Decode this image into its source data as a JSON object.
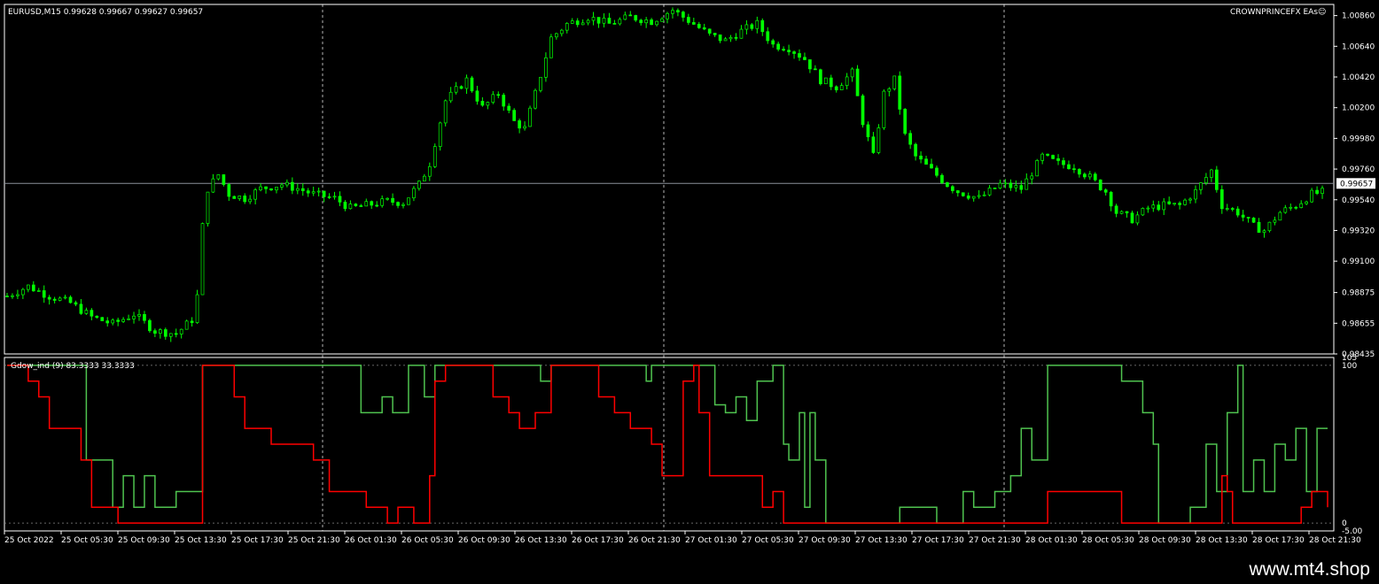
{
  "header": {
    "symbol_line": "EURUSD,M15  0.99628 0.99667 0.99627 0.99657",
    "brand": "CROWNPRINCEFX EAs☺"
  },
  "indicator_header": "Gdow_ind (9) 83.3333 33.3333",
  "current_price_label": "0.99657",
  "watermark": "www.mt4.shop",
  "colors": {
    "bull": "#00ff00",
    "bear": "#00ff00",
    "green_line": "#4fc34f",
    "red_line": "#ff0000",
    "grid": "#c0c0c0"
  },
  "chart_data": [
    {
      "type": "candlestick",
      "title": "EURUSD,M15",
      "ylim": [
        0.98435,
        0.1
      ],
      "y_ticks": [
        "1.00860",
        "1.00640",
        "1.00420",
        "1.00200",
        "0.99980",
        "0.99760",
        "0.99540",
        "0.99320",
        "0.99100",
        "0.98875",
        "0.98655",
        "0.98435"
      ],
      "current_price": 0.99657,
      "x_ticks": [
        "25 Oct 2022",
        "25 Oct 05:30",
        "25 Oct 09:30",
        "25 Oct 13:30",
        "25 Oct 17:30",
        "25 Oct 21:30",
        "26 Oct 01:30",
        "26 Oct 05:30",
        "26 Oct 09:30",
        "26 Oct 13:30",
        "26 Oct 17:30",
        "26 Oct 21:30",
        "27 Oct 01:30",
        "27 Oct 05:30",
        "27 Oct 09:30",
        "27 Oct 13:30",
        "27 Oct 17:30",
        "27 Oct 21:30",
        "28 Oct 01:30",
        "28 Oct 05:30",
        "28 Oct 09:30",
        "28 Oct 13:30",
        "28 Oct 17:30",
        "28 Oct 21:30"
      ],
      "close_path": [
        [
          0,
          0.9885
        ],
        [
          4,
          0.9892
        ],
        [
          8,
          0.9885
        ],
        [
          12,
          0.988
        ],
        [
          16,
          0.987
        ],
        [
          20,
          0.9865
        ],
        [
          24,
          0.9872
        ],
        [
          28,
          0.986
        ],
        [
          32,
          0.9858
        ],
        [
          35,
          0.9868
        ],
        [
          36,
          0.9885
        ],
        [
          37,
          0.9935
        ],
        [
          38,
          0.9962
        ],
        [
          40,
          0.9972
        ],
        [
          42,
          0.9958
        ],
        [
          45,
          0.9955
        ],
        [
          48,
          0.9962
        ],
        [
          52,
          0.9965
        ],
        [
          55,
          0.9962
        ],
        [
          58,
          0.9958
        ],
        [
          62,
          0.9955
        ],
        [
          65,
          0.9948
        ],
        [
          68,
          0.995
        ],
        [
          72,
          0.9953
        ],
        [
          75,
          0.9952
        ],
        [
          78,
          0.9965
        ],
        [
          80,
          0.998
        ],
        [
          83,
          1.0025
        ],
        [
          87,
          1.004
        ],
        [
          90,
          1.002
        ],
        [
          93,
          1.003
        ],
        [
          96,
          1.001
        ],
        [
          98,
          1.0005
        ],
        [
          100,
          1.003
        ],
        [
          103,
          1.007
        ],
        [
          106,
          1.008
        ],
        [
          110,
          1.0085
        ],
        [
          114,
          1.008
        ],
        [
          118,
          1.0085
        ],
        [
          122,
          1.0082
        ],
        [
          126,
          1.009
        ],
        [
          130,
          1.008
        ],
        [
          133,
          1.0072
        ],
        [
          136,
          1.0068
        ],
        [
          139,
          1.0075
        ],
        [
          142,
          1.008
        ],
        [
          145,
          1.0065
        ],
        [
          148,
          1.0063
        ],
        [
          151,
          1.0055
        ],
        [
          154,
          1.004
        ],
        [
          157,
          1.0035
        ],
        [
          160,
          1.0045
        ],
        [
          162,
          1.001
        ],
        [
          164,
          0.9985
        ],
        [
          166,
          1.003
        ],
        [
          168,
          1.004
        ],
        [
          170,
          1.0
        ],
        [
          172,
          0.9985
        ],
        [
          175,
          0.9975
        ],
        [
          178,
          0.9965
        ],
        [
          180,
          0.996
        ],
        [
          184,
          0.9955
        ],
        [
          188,
          0.9965
        ],
        [
          192,
          0.9962
        ],
        [
          196,
          0.9985
        ],
        [
          199,
          0.998
        ],
        [
          202,
          0.9978
        ],
        [
          205,
          0.997
        ],
        [
          208,
          0.996
        ],
        [
          210,
          0.9945
        ],
        [
          213,
          0.994
        ],
        [
          216,
          0.9948
        ],
        [
          219,
          0.995
        ],
        [
          222,
          0.995
        ],
        [
          225,
          0.996
        ],
        [
          228,
          0.9975
        ],
        [
          230,
          0.995
        ],
        [
          233,
          0.9945
        ],
        [
          236,
          0.9935
        ],
        [
          238,
          0.9932
        ],
        [
          241,
          0.9945
        ],
        [
          244,
          0.995
        ],
        [
          247,
          0.9958
        ],
        [
          250,
          0.996
        ]
      ],
      "bars_total": 250
    },
    {
      "type": "line",
      "title": "Gdow_ind (9) 83.3333 33.3333",
      "ylim": [
        0,
        100
      ],
      "y_ticks": [
        "105",
        "100",
        "0",
        "-5.00"
      ],
      "series": [
        {
          "color": "#4fc34f",
          "values_path": [
            [
              0,
              100
            ],
            [
              14,
              100
            ],
            [
              15,
              40
            ],
            [
              18,
              40
            ],
            [
              20,
              10
            ],
            [
              22,
              30
            ],
            [
              24,
              10
            ],
            [
              26,
              30
            ],
            [
              28,
              10
            ],
            [
              32,
              20
            ],
            [
              35,
              20
            ],
            [
              37,
              100
            ],
            [
              66,
              100
            ],
            [
              67,
              70
            ],
            [
              70,
              70
            ],
            [
              71,
              80
            ],
            [
              73,
              70
            ],
            [
              75,
              70
            ],
            [
              76,
              100
            ],
            [
              78,
              100
            ],
            [
              79,
              80
            ],
            [
              81,
              100
            ],
            [
              83,
              100
            ],
            [
              100,
              100
            ],
            [
              101,
              90
            ],
            [
              103,
              100
            ],
            [
              120,
              100
            ],
            [
              121,
              90
            ],
            [
              122,
              100
            ],
            [
              133,
              100
            ],
            [
              134,
              75
            ],
            [
              136,
              70
            ],
            [
              138,
              80
            ],
            [
              140,
              65
            ],
            [
              142,
              90
            ],
            [
              145,
              100
            ],
            [
              147,
              50
            ],
            [
              148,
              40
            ],
            [
              150,
              70
            ],
            [
              151,
              10
            ],
            [
              152,
              70
            ],
            [
              153,
              40
            ],
            [
              155,
              0
            ],
            [
              168,
              0
            ],
            [
              169,
              10
            ],
            [
              175,
              10
            ],
            [
              176,
              0
            ],
            [
              180,
              0
            ],
            [
              181,
              20
            ],
            [
              183,
              10
            ],
            [
              187,
              20
            ],
            [
              190,
              30
            ],
            [
              192,
              60
            ],
            [
              194,
              40
            ],
            [
              197,
              100
            ],
            [
              210,
              100
            ],
            [
              211,
              90
            ],
            [
              213,
              90
            ],
            [
              215,
              70
            ],
            [
              217,
              50
            ],
            [
              218,
              0
            ],
            [
              222,
              0
            ],
            [
              224,
              10
            ],
            [
              227,
              50
            ],
            [
              229,
              20
            ],
            [
              231,
              70
            ],
            [
              233,
              100
            ],
            [
              234,
              20
            ],
            [
              236,
              40
            ],
            [
              238,
              20
            ],
            [
              240,
              50
            ],
            [
              242,
              40
            ],
            [
              244,
              60
            ],
            [
              246,
              20
            ],
            [
              248,
              60
            ],
            [
              250,
              60
            ]
          ]
        },
        {
          "color": "#ff0000",
          "values_path": [
            [
              0,
              100
            ],
            [
              3,
              100
            ],
            [
              4,
              90
            ],
            [
              6,
              80
            ],
            [
              8,
              60
            ],
            [
              12,
              60
            ],
            [
              14,
              40
            ],
            [
              16,
              10
            ],
            [
              20,
              10
            ],
            [
              21,
              0
            ],
            [
              36,
              0
            ],
            [
              37,
              100
            ],
            [
              41,
              100
            ],
            [
              43,
              80
            ],
            [
              45,
              60
            ],
            [
              50,
              50
            ],
            [
              55,
              50
            ],
            [
              58,
              40
            ],
            [
              61,
              20
            ],
            [
              65,
              20
            ],
            [
              68,
              10
            ],
            [
              72,
              0
            ],
            [
              74,
              10
            ],
            [
              77,
              0
            ],
            [
              80,
              30
            ],
            [
              81,
              90
            ],
            [
              83,
              100
            ],
            [
              90,
              100
            ],
            [
              92,
              80
            ],
            [
              95,
              70
            ],
            [
              97,
              60
            ],
            [
              100,
              70
            ],
            [
              103,
              100
            ],
            [
              110,
              100
            ],
            [
              112,
              80
            ],
            [
              115,
              70
            ],
            [
              118,
              60
            ],
            [
              122,
              50
            ],
            [
              124,
              30
            ],
            [
              127,
              30
            ],
            [
              128,
              90
            ],
            [
              130,
              100
            ],
            [
              131,
              70
            ],
            [
              133,
              30
            ],
            [
              140,
              30
            ],
            [
              143,
              10
            ],
            [
              145,
              20
            ],
            [
              147,
              0
            ],
            [
              195,
              0
            ],
            [
              197,
              20
            ],
            [
              210,
              20
            ],
            [
              211,
              0
            ],
            [
              228,
              0
            ],
            [
              230,
              30
            ],
            [
              231,
              20
            ],
            [
              232,
              0
            ],
            [
              244,
              0
            ],
            [
              245,
              10
            ],
            [
              247,
              20
            ],
            [
              250,
              10
            ]
          ]
        }
      ]
    }
  ]
}
